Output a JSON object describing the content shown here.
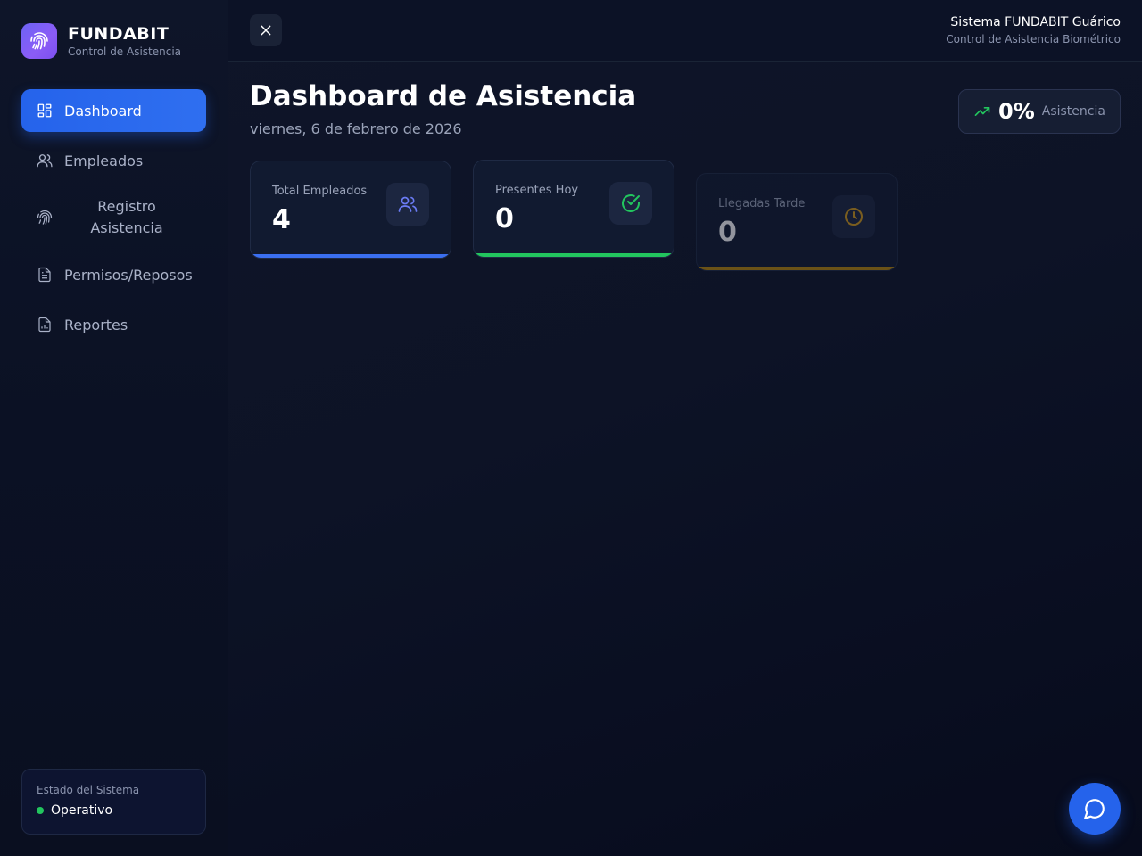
{
  "brand": {
    "title": "FUNDABIT",
    "subtitle": "Control de Asistencia"
  },
  "sidebar": {
    "items": [
      {
        "label": "Dashboard",
        "icon": "dashboard-icon",
        "active": true
      },
      {
        "label": "Empleados",
        "icon": "users-icon",
        "active": false
      },
      {
        "label": "Registro Asistencia",
        "icon": "fingerprint-icon",
        "active": false
      },
      {
        "label": "Permisos/Reposos",
        "icon": "document-icon",
        "active": false
      },
      {
        "label": "Reportes",
        "icon": "report-icon",
        "active": false
      }
    ]
  },
  "system_status": {
    "title": "Estado del Sistema",
    "value": "Operativo",
    "color": "#22c55e"
  },
  "topbar": {
    "system_title": "Sistema FUNDABIT Guárico",
    "system_subtitle": "Control de Asistencia Biométrico"
  },
  "page": {
    "title": "Dashboard de Asistencia",
    "date": "viernes, 6 de febrero de 2026"
  },
  "attendance_badge": {
    "value": "0%",
    "label": "Asistencia",
    "icon": "trending-up-icon"
  },
  "stats": [
    {
      "label": "Total Empleados",
      "value": "4",
      "icon": "users-icon",
      "color": "#3b6ff0"
    },
    {
      "label": "Presentes Hoy",
      "value": "0",
      "icon": "check-circle-icon",
      "color": "#22c55e"
    },
    {
      "label": "Llegadas Tarde",
      "value": "0",
      "icon": "clock-icon",
      "color": "#b8860b"
    }
  ],
  "colors": {
    "accent": "#2563eb",
    "brand_gradient_start": "#6d63f5",
    "brand_gradient_end": "#8b5cf6",
    "chat_button": "#2563eb"
  },
  "chat_button": {
    "icon": "chat-bubble-icon"
  }
}
